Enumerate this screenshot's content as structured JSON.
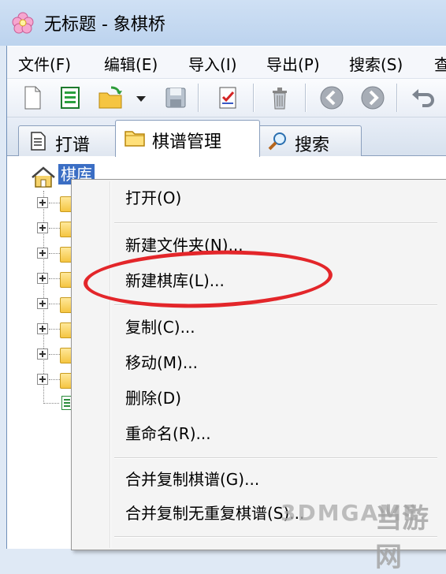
{
  "window": {
    "title": "无标题 - 象棋桥"
  },
  "menubar": {
    "items": [
      "文件(F)",
      "编辑(E)",
      "导入(I)",
      "导出(P)",
      "搜索(S)",
      "查"
    ]
  },
  "toolbar": {
    "buttons": [
      "new-file-icon",
      "list-icon",
      "open-folder-icon",
      "dropdown-icon",
      "save-icon",
      "checklist-icon",
      "trash-icon",
      "back-icon",
      "forward-icon",
      "undo-icon"
    ]
  },
  "tabs": [
    {
      "label": "打谱",
      "icon": "document-icon",
      "active": false
    },
    {
      "label": "棋谱管理",
      "icon": "folder-icon",
      "active": true
    },
    {
      "label": "搜索",
      "icon": "magnifier-icon",
      "active": false
    }
  ],
  "tree": {
    "root_label": "棋库",
    "root_icon": "house-icon"
  },
  "context_menu": {
    "items": [
      {
        "label": "打开(O)"
      },
      {
        "label": "新建文件夹(N)..."
      },
      {
        "label": "新建棋库(L)..."
      },
      {
        "label": "复制(C)..."
      },
      {
        "label": "移动(M)..."
      },
      {
        "label": "删除(D)"
      },
      {
        "label": "重命名(R)..."
      },
      {
        "label": "合并复制棋谱(G)..."
      },
      {
        "label": "合并复制无重复棋谱(S)..."
      }
    ],
    "highlighted": "新建棋库(L)..."
  },
  "watermark": {
    "logo": "3DMGAME",
    "text": "当游网"
  },
  "colors": {
    "selection": "#3b6ec4",
    "highlight_ring": "#e3262a"
  }
}
